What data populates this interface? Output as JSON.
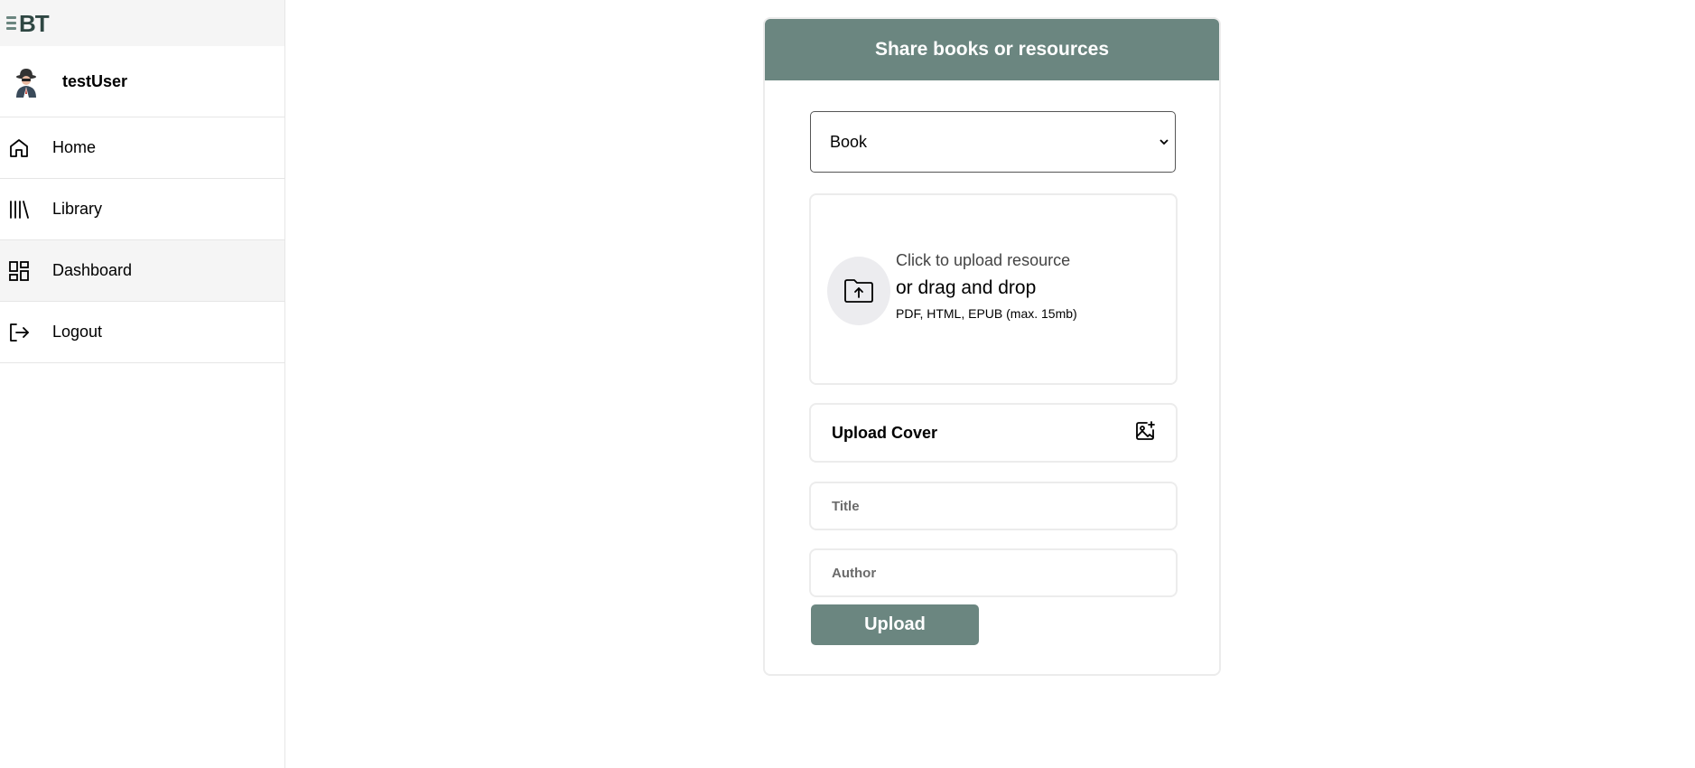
{
  "app": {
    "logo_text": "BT"
  },
  "user": {
    "name": "testUser",
    "avatar_icon": "spy-avatar-icon"
  },
  "nav": {
    "items": [
      {
        "label": "Home",
        "icon": "home-icon"
      },
      {
        "label": "Library",
        "icon": "library-icon"
      },
      {
        "label": "Dashboard",
        "icon": "dashboard-icon",
        "active": true
      },
      {
        "label": "Logout",
        "icon": "logout-icon"
      }
    ]
  },
  "form": {
    "header": "Share books or resources",
    "type_select": {
      "value": "Book"
    },
    "dropzone": {
      "primary": "Click to upload resource",
      "secondary": "or drag and drop",
      "hint": "PDF, HTML, EPUB (max. 15mb)",
      "icon": "folder-upload-icon"
    },
    "cover": {
      "label": "Upload Cover",
      "icon": "image-plus-icon"
    },
    "title_placeholder": "Title",
    "author_placeholder": "Author",
    "submit_label": "Upload"
  },
  "colors": {
    "accent": "#6b8680",
    "logo_dark": "#2f4743",
    "active_bg": "#f5f5f5"
  }
}
